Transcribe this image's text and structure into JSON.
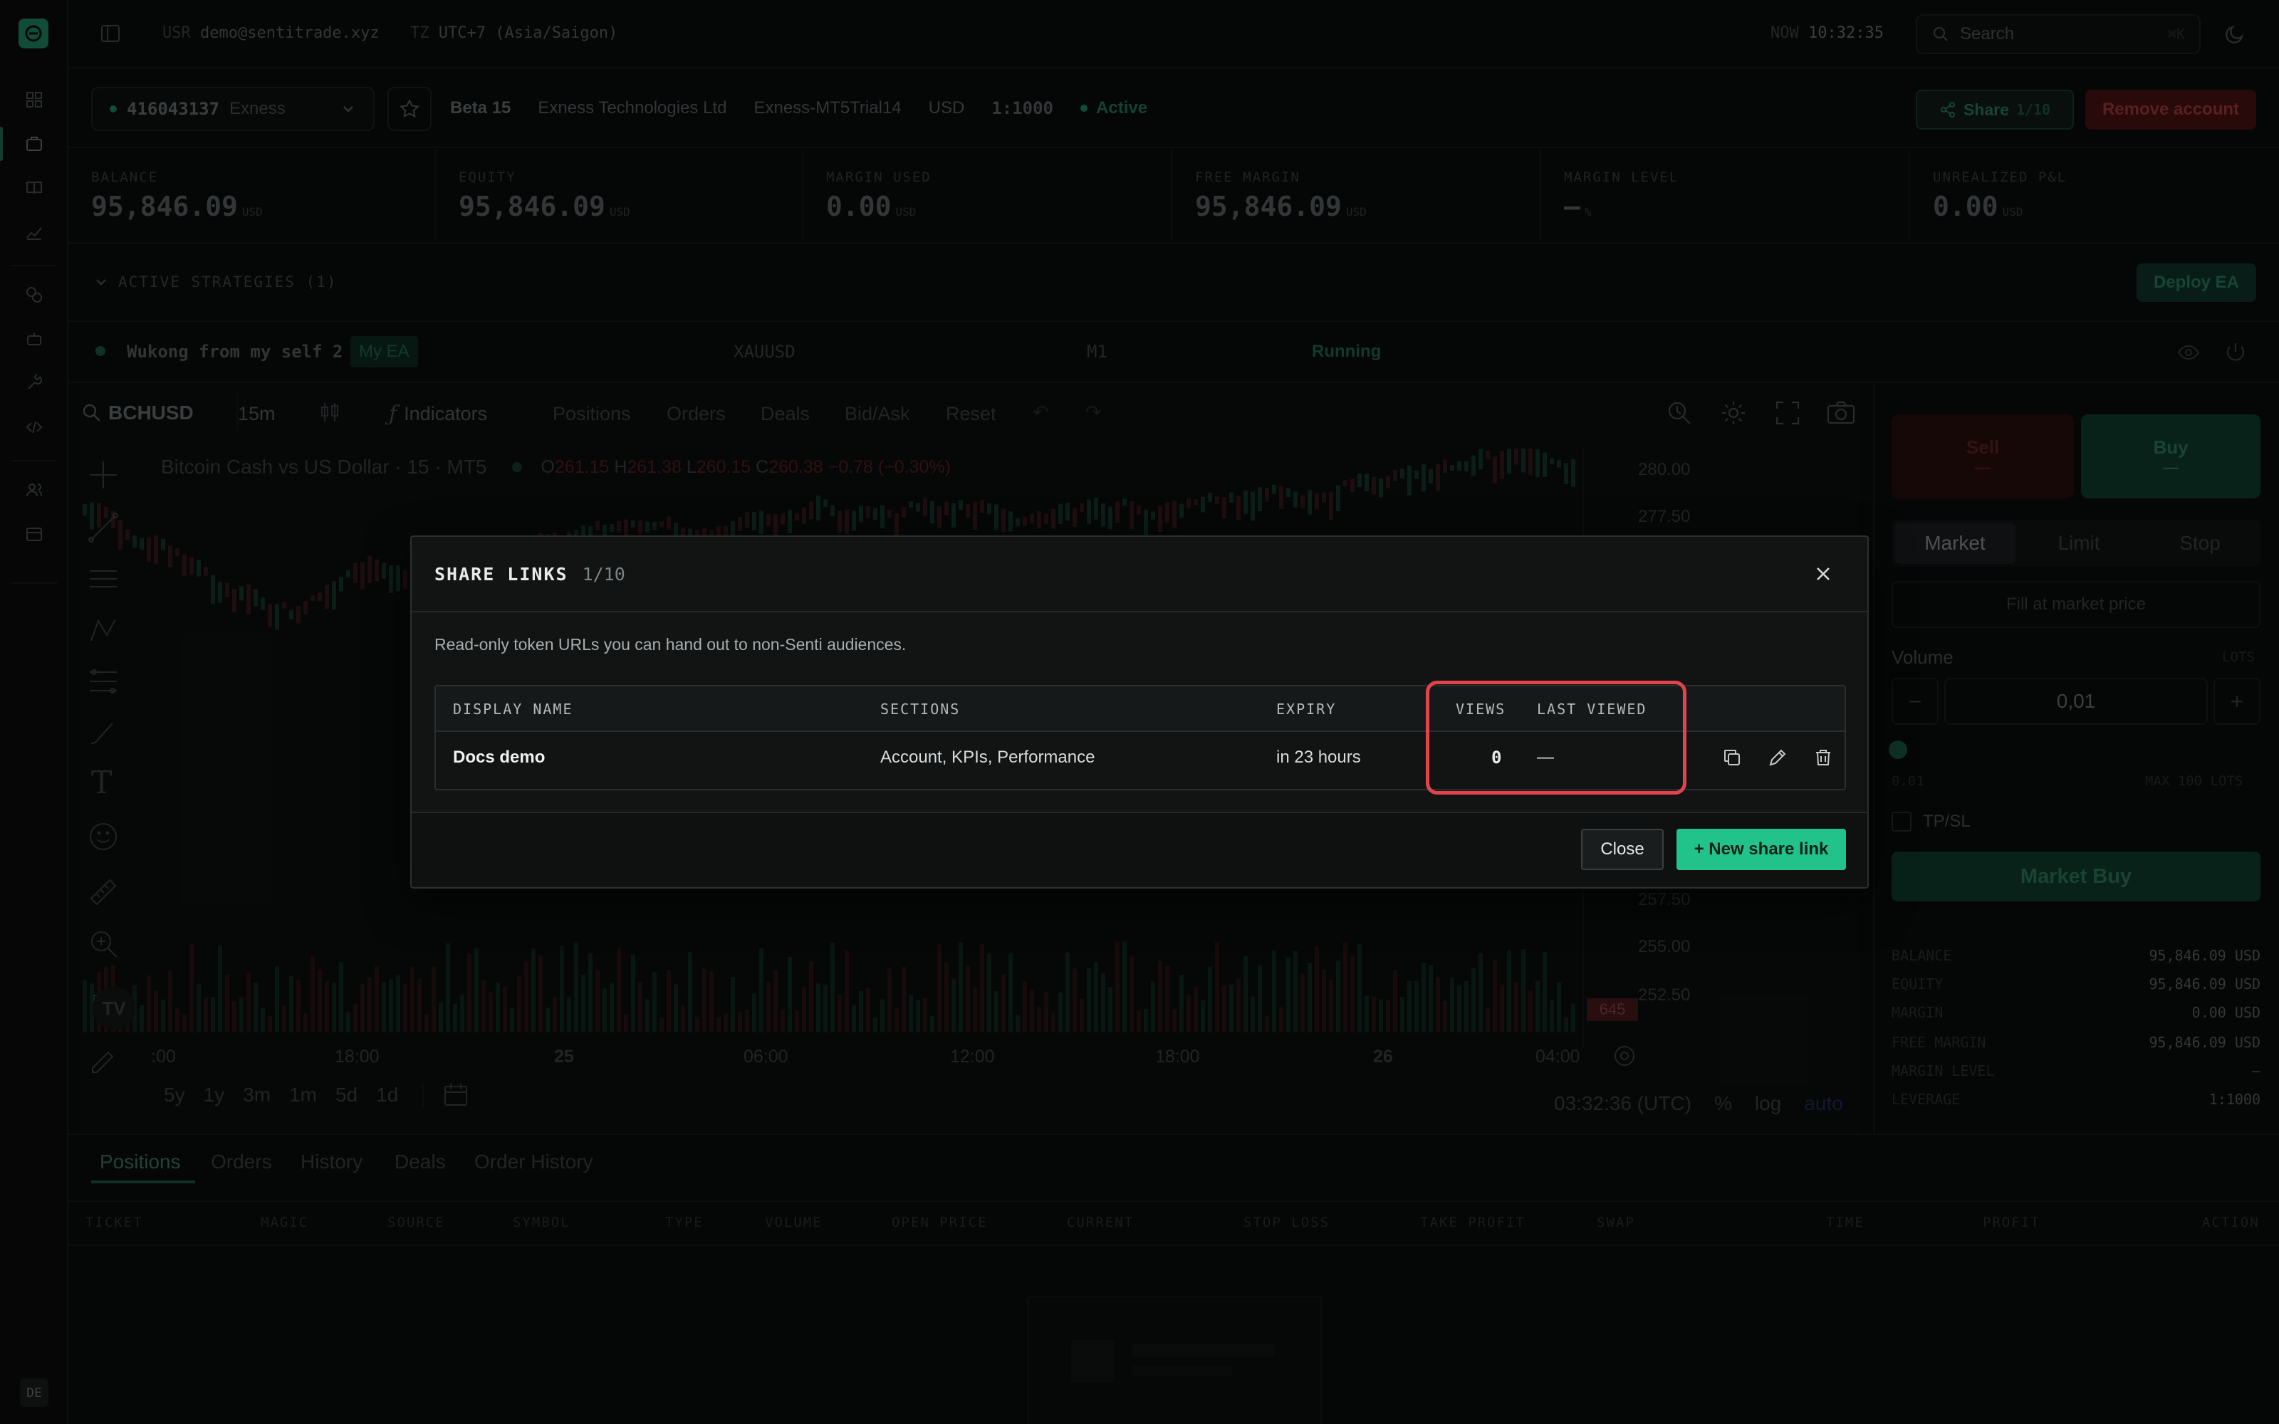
{
  "topbar": {
    "usr_label": "USR",
    "usr_value": "demo@sentitrade.xyz",
    "tz_label": "TZ",
    "tz_value": "UTC+7 (Asia/Saigon)",
    "now_label": "NOW",
    "now_value": "10:32:35",
    "search_placeholder": "Search",
    "search_shortcut": "⌘K"
  },
  "account": {
    "number": "416043137",
    "broker": "Exness",
    "plan": "Beta 15",
    "company": "Exness Technologies Ltd",
    "server": "Exness-MT5Trial14",
    "currency": "USD",
    "leverage": "1:1000",
    "status": "Active",
    "share_label": "Share",
    "share_count": "1/10",
    "remove_label": "Remove account"
  },
  "kpis": [
    {
      "label": "BALANCE",
      "value": "95,846.09",
      "unit": "USD"
    },
    {
      "label": "EQUITY",
      "value": "95,846.09",
      "unit": "USD"
    },
    {
      "label": "MARGIN USED",
      "value": "0.00",
      "unit": "USD"
    },
    {
      "label": "FREE MARGIN",
      "value": "95,846.09",
      "unit": "USD"
    },
    {
      "label": "MARGIN LEVEL",
      "value": "—",
      "unit": "%"
    },
    {
      "label": "UNREALIZED P&L",
      "value": "0.00",
      "unit": "USD"
    }
  ],
  "strategies": {
    "header": "ACTIVE STRATEGIES (1)",
    "deploy_label": "Deploy EA",
    "row": {
      "name": "Wukong from my self 2",
      "tag": "My EA",
      "symbol": "XAUUSD",
      "timeframe": "M1",
      "status": "Running"
    }
  },
  "chart": {
    "symbol": "BCHUSD",
    "interval": "15m",
    "toolbar": [
      "Indicators",
      "Positions",
      "Orders",
      "Deals",
      "Bid/Ask",
      "Reset"
    ],
    "title": "Bitcoin Cash vs US Dollar · 15 · MT5",
    "ohlc": {
      "o_label": "O",
      "o": "261.15",
      "h_label": "H",
      "h": "261.38",
      "l_label": "L",
      "l": "260.15",
      "c_label": "C",
      "c": "260.38",
      "change": "−0.78 (−0.30%)"
    },
    "prices": [
      "280.00",
      "277.50",
      "257.50",
      "255.00",
      "252.50"
    ],
    "last_price_tag": "645",
    "time_labels": [
      ":00",
      "18:00",
      "25",
      "06:00",
      "12:00",
      "18:00",
      "26",
      "04:00"
    ],
    "ranges": [
      "5y",
      "1y",
      "3m",
      "1m",
      "5d",
      "1d"
    ],
    "clock": "03:32:36 (UTC)",
    "scale_opts": [
      "%",
      "log",
      "auto"
    ]
  },
  "order": {
    "sell": "Sell",
    "sell_price": "—",
    "buy": "Buy",
    "buy_price": "—",
    "tabs": [
      "Market",
      "Limit",
      "Stop"
    ],
    "fill_hint": "Fill at market price",
    "volume_label": "Volume",
    "volume_unit": "LOTS",
    "volume_value": "0,01",
    "min_lots": "0.01",
    "max_lots": "MAX 100 LOTS",
    "tpsl": "TP/SL",
    "market_buy": "Market Buy",
    "summary": [
      {
        "k": "BALANCE",
        "v": "95,846.09 USD"
      },
      {
        "k": "EQUITY",
        "v": "95,846.09 USD"
      },
      {
        "k": "MARGIN",
        "v": "0.00 USD"
      },
      {
        "k": "FREE MARGIN",
        "v": "95,846.09 USD"
      },
      {
        "k": "MARGIN LEVEL",
        "v": "—"
      },
      {
        "k": "LEVERAGE",
        "v": "1:1000"
      }
    ]
  },
  "bottom": {
    "tabs": [
      "Positions",
      "Orders",
      "History",
      "Deals",
      "Order History"
    ],
    "columns": [
      "TICKET",
      "MAGIC",
      "SOURCE",
      "SYMBOL",
      "TYPE",
      "VOLUME",
      "OPEN PRICE",
      "CURRENT",
      "STOP LOSS",
      "TAKE PROFIT",
      "SWAP",
      "TIME",
      "PROFIT",
      "ACTION"
    ]
  },
  "rail": {
    "lang": "DE"
  },
  "modal": {
    "title": "SHARE LINKS",
    "count": "1/10",
    "description": "Read-only token URLs you can hand out to non-Senti audiences.",
    "columns": {
      "display_name": "DISPLAY NAME",
      "sections": "SECTIONS",
      "expiry": "EXPIRY",
      "views": "VIEWS",
      "last_viewed": "LAST VIEWED"
    },
    "rows": [
      {
        "display_name": "Docs demo",
        "sections": "Account, KPIs, Performance",
        "expiry": "in 23 hours",
        "views": "0",
        "last_viewed": "—"
      }
    ],
    "close_label": "Close",
    "new_label": "+ New share link"
  }
}
